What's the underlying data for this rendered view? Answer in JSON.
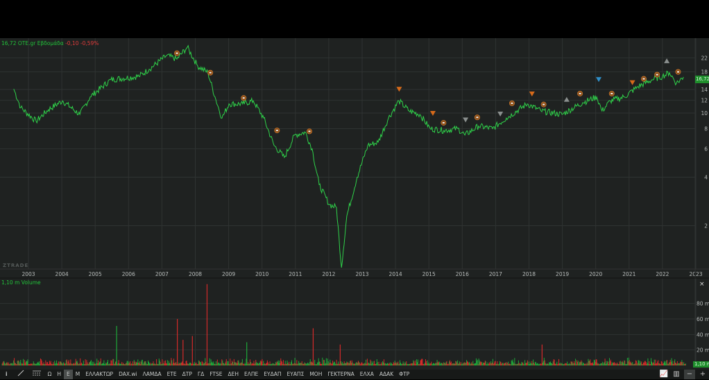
{
  "header": {
    "last": "16,72",
    "symbol": "OTE.gr",
    "period": "Εβδομάδα",
    "change": "-0,10",
    "change_pct": "-0,59%"
  },
  "watermark": "ZTRADE",
  "volume_panel": {
    "label": "1,10 m Volume",
    "last": "1,10 m",
    "close": "×"
  },
  "last_price_badge": "16,72",
  "colors": {
    "line": "#2fd24a",
    "up": "#1fa83a",
    "down": "#d42a2a",
    "bg": "#1f2221",
    "grid": "#2f3332"
  },
  "toolbar": {
    "items": [
      "Ω",
      "Η",
      "Ε",
      "Μ",
      "ΕΛΛΑΚΤΩΡ",
      "DAX.wi",
      "ΛΑΜΔΑ",
      "ΕΤΕ",
      "ΔΤΡ",
      "ΓΔ",
      "FTSE",
      "ΔΕΗ",
      "ΕΛΠΕ",
      "ΕΥΔΑΠ",
      "ΕΥΑΠΣ",
      "ΜΟΗ",
      "ΓΕΚΤΕΡΝΑ",
      "ΕΛΧΑ",
      "ΑΔΑΚ",
      "ΦΤΡ"
    ],
    "active": "Ε"
  },
  "chart_data": {
    "type": "line",
    "title": "OTE.gr Εβδομάδα",
    "yscale": "log",
    "yticks": [
      2,
      4,
      6,
      8,
      10,
      12,
      14,
      18,
      22
    ],
    "ylim": [
      1,
      28
    ],
    "xticks": [
      "2003",
      "2004",
      "2005",
      "2006",
      "2007",
      "2008",
      "2009",
      "2010",
      "2011",
      "2012",
      "2013",
      "2014",
      "2015",
      "2016",
      "2017",
      "2018",
      "2019",
      "2020",
      "2021",
      "2022",
      "2023"
    ],
    "xlim": [
      2002.15,
      2023.0
    ],
    "series": [
      {
        "name": "OTE.gr",
        "x": [
          2002.56,
          2002.77,
          2003.23,
          2003.6,
          2004.02,
          2004.54,
          2004.85,
          2005.47,
          2006.31,
          2006.62,
          2007.14,
          2007.45,
          2007.76,
          2008.07,
          2008.38,
          2008.59,
          2008.8,
          2009.01,
          2009.42,
          2009.74,
          2010.05,
          2010.36,
          2010.67,
          2010.98,
          2011.3,
          2011.5,
          2011.71,
          2012.02,
          2012.23,
          2012.38,
          2012.54,
          2012.85,
          2013.17,
          2013.48,
          2013.79,
          2014.1,
          2014.41,
          2014.73,
          2015.04,
          2015.45,
          2015.87,
          2016.08,
          2016.49,
          2016.91,
          2017.32,
          2017.95,
          2018.36,
          2018.99,
          2019.61,
          2020.03,
          2020.19,
          2020.44,
          2020.86,
          2021.27,
          2021.69,
          2022.0,
          2022.21,
          2022.42,
          2022.63
        ],
        "y": [
          14.1,
          10.8,
          8.9,
          10.5,
          11.9,
          9.8,
          12.6,
          16.1,
          16.9,
          18.7,
          22.7,
          21.6,
          25.6,
          19.6,
          17.8,
          12.6,
          9.3,
          11.4,
          11.4,
          11.9,
          9.3,
          6.3,
          5.3,
          7.3,
          7.6,
          6.0,
          3.6,
          2.7,
          2.6,
          1.1,
          2.3,
          4.0,
          6.3,
          6.6,
          9.3,
          11.9,
          10.3,
          9.8,
          8.0,
          7.8,
          8.0,
          7.3,
          8.3,
          8.0,
          9.3,
          11.4,
          10.3,
          9.8,
          11.6,
          12.6,
          10.3,
          11.9,
          12.6,
          14.6,
          16.1,
          16.9,
          17.8,
          15.3,
          16.72
        ]
      }
    ],
    "events": [
      {
        "x": 2007.45,
        "y": 23.5,
        "type": "dividend"
      },
      {
        "x": 2008.45,
        "y": 17.8,
        "type": "dividend"
      },
      {
        "x": 2009.45,
        "y": 12.4,
        "type": "dividend"
      },
      {
        "x": 2010.45,
        "y": 7.8,
        "type": "dividend"
      },
      {
        "x": 2011.42,
        "y": 7.7,
        "type": "dividend"
      },
      {
        "x": 2014.11,
        "y": 14.1,
        "type": "earnings"
      },
      {
        "x": 2015.12,
        "y": 10.0,
        "type": "earnings"
      },
      {
        "x": 2015.44,
        "y": 8.7,
        "type": "dividend"
      },
      {
        "x": 2016.1,
        "y": 9.1,
        "type": "earnings-neutral"
      },
      {
        "x": 2016.45,
        "y": 9.4,
        "type": "dividend"
      },
      {
        "x": 2017.14,
        "y": 9.9,
        "type": "earnings-neutral"
      },
      {
        "x": 2017.49,
        "y": 11.5,
        "type": "dividend"
      },
      {
        "x": 2018.09,
        "y": 13.2,
        "type": "earnings"
      },
      {
        "x": 2018.44,
        "y": 11.3,
        "type": "dividend"
      },
      {
        "x": 2019.13,
        "y": 12.1,
        "type": "earnings-neutral"
      },
      {
        "x": 2019.53,
        "y": 13.2,
        "type": "dividend"
      },
      {
        "x": 2020.09,
        "y": 16.2,
        "type": "earnings-blue"
      },
      {
        "x": 2020.48,
        "y": 13.2,
        "type": "dividend"
      },
      {
        "x": 2021.1,
        "y": 15.5,
        "type": "earnings"
      },
      {
        "x": 2021.44,
        "y": 16.3,
        "type": "dividend"
      },
      {
        "x": 2021.84,
        "y": 17.3,
        "type": "dividend"
      },
      {
        "x": 2022.13,
        "y": 21.0,
        "type": "earnings-neutral"
      },
      {
        "x": 2022.47,
        "y": 18.0,
        "type": "dividend"
      }
    ],
    "volume": {
      "yticks": [
        20,
        40,
        60,
        80
      ],
      "unit": "m",
      "ylim": [
        0,
        110
      ],
      "spikes": [
        {
          "x": 2005.63,
          "v": 51,
          "dir": "up"
        },
        {
          "x": 2007.45,
          "v": 60,
          "dir": "down"
        },
        {
          "x": 2007.62,
          "v": 33,
          "dir": "down"
        },
        {
          "x": 2007.9,
          "v": 38,
          "dir": "down"
        },
        {
          "x": 2008.34,
          "v": 105,
          "dir": "down"
        },
        {
          "x": 2009.53,
          "v": 30,
          "dir": "up"
        },
        {
          "x": 2011.52,
          "v": 48,
          "dir": "down"
        },
        {
          "x": 2012.33,
          "v": 27,
          "dir": "down"
        },
        {
          "x": 2018.38,
          "v": 27,
          "dir": "down"
        }
      ]
    }
  }
}
